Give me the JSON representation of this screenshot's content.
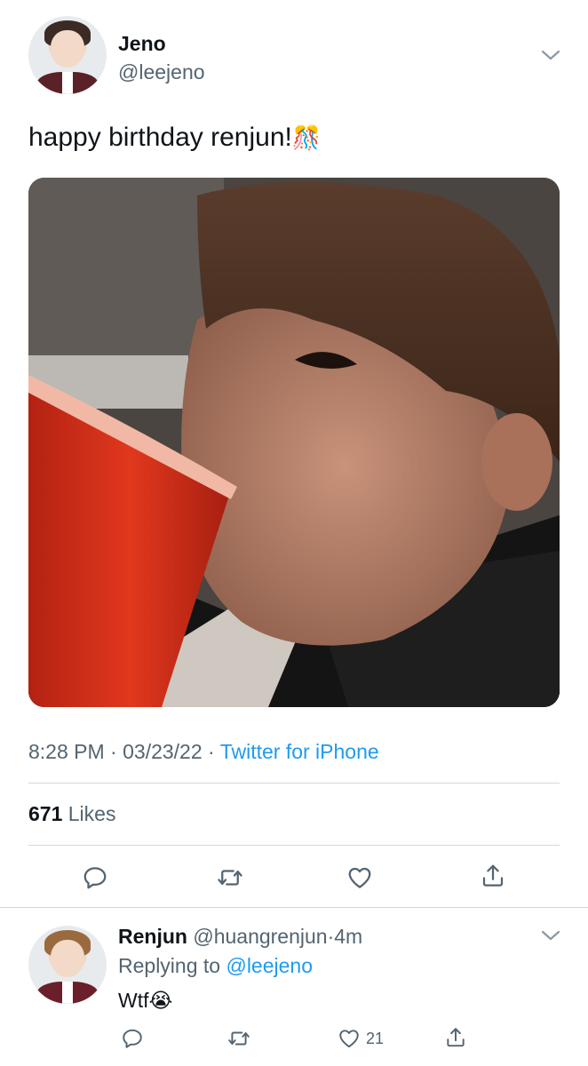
{
  "tweet": {
    "author_name": "Jeno",
    "author_handle": "@leejeno",
    "text": "happy birthday renjun!",
    "text_emoji": "🎊",
    "time": "8:28 PM",
    "sep1": "·",
    "date": "03/23/22",
    "sep2": "·",
    "source": "Twitter for iPhone",
    "likes_count": "671",
    "likes_label": "Likes"
  },
  "reply": {
    "author_name": "Renjun",
    "author_handle": "@huangrenjun",
    "sep": "·",
    "time_ago": "4m",
    "replying_prefix": "Replying to",
    "replying_to": "@leejeno",
    "text": "Wtf",
    "text_emoji": "😭",
    "like_count": "21"
  },
  "colors": {
    "accent": "#1d9bf0",
    "secondary_text": "#536471",
    "primary_text": "#0f1419",
    "divider": "#cfd9de"
  },
  "icons": {
    "reply": "reply-icon",
    "retweet": "retweet-icon",
    "like": "heart-icon",
    "share": "share-icon",
    "more": "chevron-down-icon"
  }
}
